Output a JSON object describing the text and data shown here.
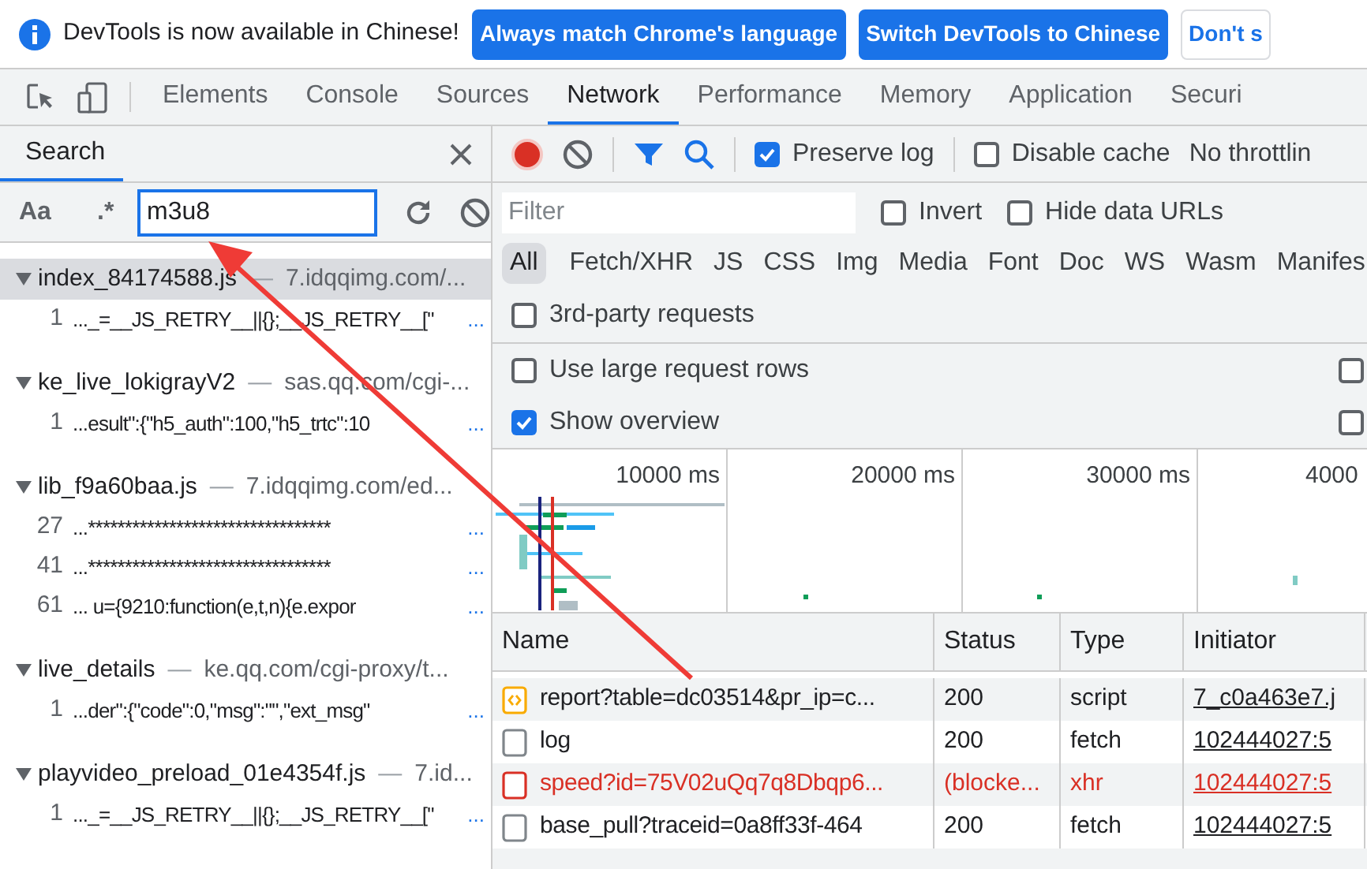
{
  "infobar": {
    "message": "DevTools is now available in Chinese!",
    "buttons": [
      {
        "label": "Always match Chrome's language",
        "kind": "primary"
      },
      {
        "label": "Switch DevTools to Chinese",
        "kind": "primary"
      },
      {
        "label": "Don't s",
        "kind": "secondary"
      }
    ]
  },
  "tabs": [
    {
      "label": "Elements",
      "selected": false
    },
    {
      "label": "Console",
      "selected": false
    },
    {
      "label": "Sources",
      "selected": false
    },
    {
      "label": "Network",
      "selected": true
    },
    {
      "label": "Performance",
      "selected": false
    },
    {
      "label": "Memory",
      "selected": false
    },
    {
      "label": "Application",
      "selected": false
    },
    {
      "label": "Securi",
      "selected": false
    }
  ],
  "search_panel": {
    "title": "Search",
    "case_button": "Aa",
    "regex_button": ".*",
    "query": "m3u8",
    "results": [
      {
        "file": "index_84174588.js",
        "separator": "—",
        "url": "7.idqqimg.com/...",
        "highlighted": true,
        "matches": [
          {
            "line": "1",
            "text": "..._=__JS_RETRY__||{};__JS_RETRY__[\"",
            "more": "..."
          }
        ]
      },
      {
        "file": "ke_live_lokigrayV2",
        "separator": "—",
        "url": "sas.qq.com/cgi-...",
        "highlighted": false,
        "matches": [
          {
            "line": "1",
            "text": "...esult\":{\"h5_auth\":100,\"h5_trtc\":10",
            "more": "..."
          }
        ]
      },
      {
        "file": "lib_f9a60baa.js",
        "separator": "—",
        "url": "7.idqqimg.com/ed...",
        "highlighted": false,
        "matches": [
          {
            "line": "27",
            "text": "...*********************************",
            "more": "..."
          },
          {
            "line": "41",
            "text": "...*********************************",
            "more": "..."
          },
          {
            "line": "61",
            "text": "... u={9210:function(e,t,n){e.expor",
            "more": "..."
          }
        ]
      },
      {
        "file": "live_details",
        "separator": "—",
        "url": "ke.qq.com/cgi-proxy/t...",
        "highlighted": false,
        "matches": [
          {
            "line": "1",
            "text": "...der\":{\"code\":0,\"msg\":\"\",\"ext_msg\"",
            "more": "..."
          }
        ]
      },
      {
        "file": "playvideo_preload_01e4354f.js",
        "separator": "—",
        "url": "7.id...",
        "highlighted": false,
        "matches": [
          {
            "line": "1",
            "text": "..._=__JS_RETRY__||{};__JS_RETRY__[\"",
            "more": "..."
          }
        ]
      }
    ]
  },
  "network": {
    "recording": true,
    "preserve_log": {
      "label": "Preserve log",
      "checked": true
    },
    "disable_cache": {
      "label": "Disable cache",
      "checked": false
    },
    "throttling": "No throttlin",
    "filter": {
      "placeholder": "Filter"
    },
    "invert": {
      "label": "Invert",
      "checked": false
    },
    "hide_data_urls": {
      "label": "Hide data URLs",
      "checked": false
    },
    "type_filters": [
      {
        "label": "All",
        "selected": true
      },
      {
        "label": "Fetch/XHR",
        "selected": false
      },
      {
        "label": "JS",
        "selected": false
      },
      {
        "label": "CSS",
        "selected": false
      },
      {
        "label": "Img",
        "selected": false
      },
      {
        "label": "Media",
        "selected": false
      },
      {
        "label": "Font",
        "selected": false
      },
      {
        "label": "Doc",
        "selected": false
      },
      {
        "label": "WS",
        "selected": false
      },
      {
        "label": "Wasm",
        "selected": false
      },
      {
        "label": "Manifes",
        "selected": false
      }
    ],
    "third_party": {
      "label": "3rd-party requests",
      "checked": false
    },
    "settings": [
      {
        "label": "Use large request rows",
        "checked": false,
        "side_checked": false
      },
      {
        "label": "Show overview",
        "checked": true,
        "side_checked": false
      }
    ],
    "overview_ticks": [
      "10000 ms",
      "20000 ms",
      "30000 ms",
      "4000"
    ],
    "columns": [
      "Name",
      "Status",
      "Type",
      "Initiator"
    ],
    "rows": [
      {
        "name": "report?table=dc03514&pr_ip=c...",
        "status": "200",
        "type": "script",
        "initiator": "7_c0a463e7.j",
        "kind": "script",
        "blocked": false
      },
      {
        "name": "log",
        "status": "200",
        "type": "fetch",
        "initiator": "102444027:5",
        "kind": "doc",
        "blocked": false
      },
      {
        "name": "speed?id=75V02uQq7q8Dbqp6...",
        "status": "(blocke...",
        "type": "xhr",
        "initiator": "102444027:5",
        "kind": "doc",
        "blocked": true
      },
      {
        "name": "base_pull?traceid=0a8ff33f-464",
        "status": "200",
        "type": "fetch",
        "initiator": "102444027:5",
        "kind": "doc",
        "blocked": false
      }
    ]
  }
}
